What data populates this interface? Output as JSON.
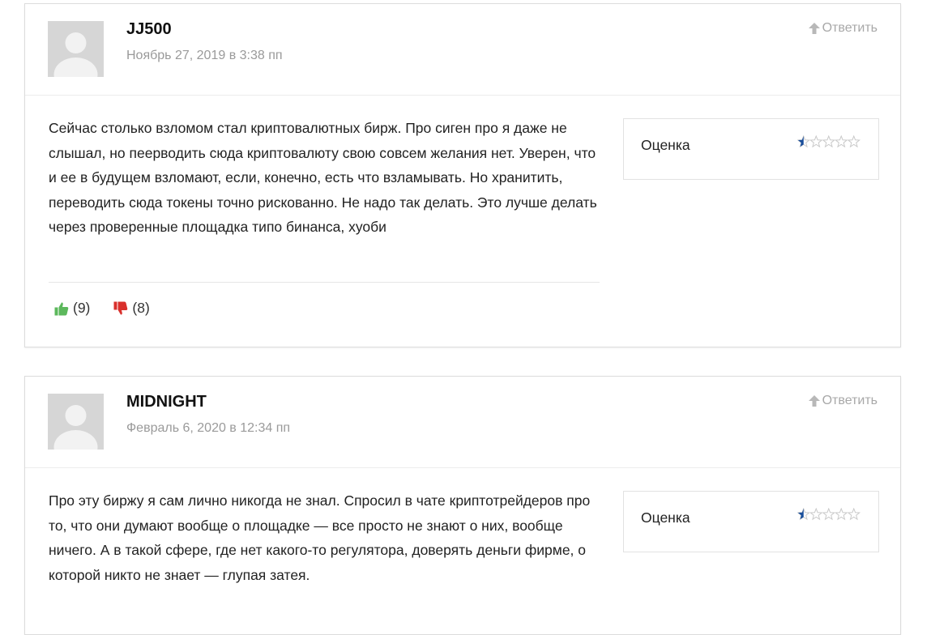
{
  "colors": {
    "like": "#5cb85c",
    "dislike": "#d9302c",
    "star_fill": "#1a4f9c",
    "star_empty": "#c9c9c9",
    "muted_text": "#9a9a9a"
  },
  "comments": [
    {
      "author": "JJ500",
      "date": "Ноябрь 27, 2019 в 3:38 пп",
      "reply_label": "Ответить",
      "text": "Сейчас столько взломом стал криптовалютных бирж. Про сиген про я даже не слышал, но пеерводить сюда криптовалюту свою совсем желания нет. Уверен, что и ее в будущем взломают, если, конечно, есть что взламывать. Но хранитить, переводить сюда токены точно рискованно. Не надо так делать. Это лучше делать через проверенные площадка типо бинанса, хуоби",
      "rating_label": "Оценка",
      "rating_value": 0.5,
      "rating_max": 5,
      "likes": "(9)",
      "dislikes": "(8)"
    },
    {
      "author": "MIDNIGHT",
      "date": "Февраль 6, 2020 в 12:34 пп",
      "reply_label": "Ответить",
      "text": "Про эту биржу я сам лично никогда не знал. Спросил в чате криптотрейдеров про то, что они думают вообще о площадке — все просто не знают о них, вообще ничего. А в такой сфере, где нет какого-то регулятора, доверять деньги фирме, о которой никто не знает — глупая затея.",
      "rating_label": "Оценка",
      "rating_value": 0.5,
      "rating_max": 5
    }
  ]
}
